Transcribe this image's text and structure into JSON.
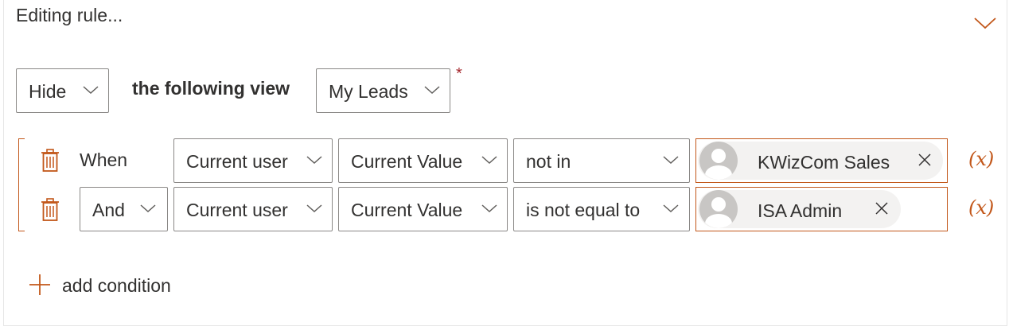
{
  "header": {
    "title": "Editing rule..."
  },
  "action": {
    "selected": "Hide",
    "middle_text": "the following view",
    "view_selected": "My Leads",
    "required_marker": "*"
  },
  "conditions": [
    {
      "connector": "When",
      "field": "Current user",
      "value_type": "Current Value",
      "operator": "not in",
      "people": [
        "KWizCom Sales"
      ],
      "fx_label": "(x)"
    },
    {
      "connector": "And",
      "field": "Current user",
      "value_type": "Current Value",
      "operator": "is not equal to",
      "people": [
        "ISA Admin"
      ],
      "fx_label": "(x)"
    }
  ],
  "add_condition_label": "add condition",
  "colors": {
    "accent": "#c2571a",
    "border": "#8a8886",
    "required": "#a4262c",
    "text": "#323130"
  },
  "icons": {
    "collapse": "chevron-down-icon",
    "delete": "trash-icon",
    "add": "plus-icon",
    "remove": "close-icon",
    "person": "avatar-icon"
  }
}
